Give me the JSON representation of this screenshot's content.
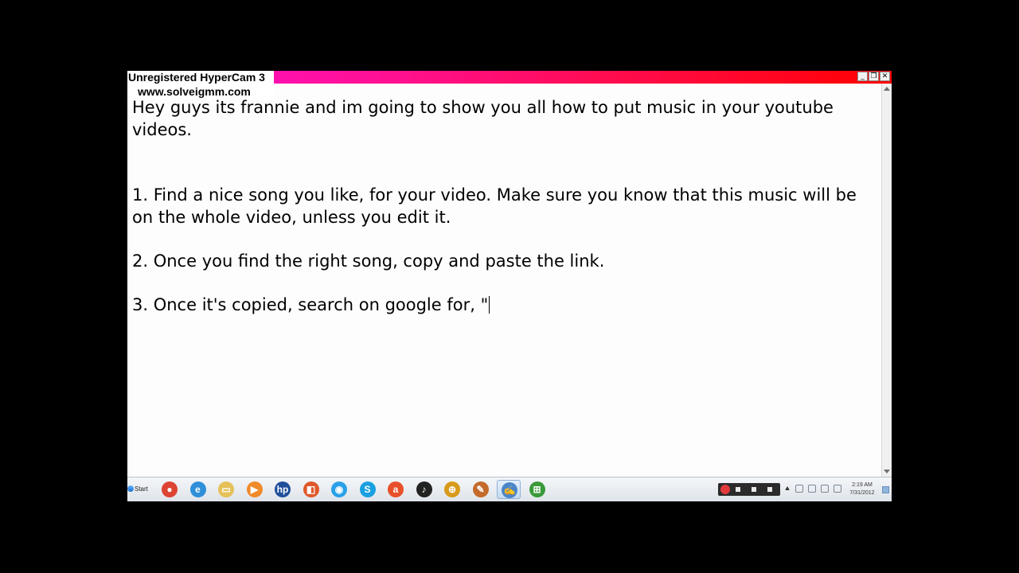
{
  "watermark": {
    "line1": "Unregistered HyperCam 3",
    "line2": "www.solveigmm.com"
  },
  "window_controls": {
    "minimize": "_",
    "restore": "❐",
    "close": "✕"
  },
  "document": {
    "lines": [
      "Hey guys its frannie and im going to show you all how to put music in your youtube videos.",
      "",
      "",
      "1. Find a nice song you like, for your video. Make sure you know that this music will be on the whole video, unless you edit it.",
      "",
      "2. Once you find the right song, copy and paste the link.",
      "",
      "3. Once it's copied, search on google for, \""
    ]
  },
  "taskbar": {
    "start_label": "Start",
    "pinned": [
      {
        "name": "chrome-icon",
        "glyph": "●",
        "color": "#dd4433"
      },
      {
        "name": "internet-explorer-icon",
        "glyph": "e",
        "color": "#2f8fd8"
      },
      {
        "name": "folder-icon",
        "glyph": "▭",
        "color": "#e6c15a"
      },
      {
        "name": "media-player-icon",
        "glyph": "▶",
        "color": "#f08a2a"
      },
      {
        "name": "hp-icon",
        "glyph": "hp",
        "color": "#1f4f9a"
      },
      {
        "name": "office-icon",
        "glyph": "◧",
        "color": "#e0582a"
      },
      {
        "name": "orb-app-icon",
        "glyph": "◉",
        "color": "#2aa0e8"
      },
      {
        "name": "skype-icon",
        "glyph": "S",
        "color": "#19a0e0"
      },
      {
        "name": "aim-icon",
        "glyph": "a",
        "color": "#e8502a"
      },
      {
        "name": "music-app-icon",
        "glyph": "♪",
        "color": "#222222"
      },
      {
        "name": "globe-icon",
        "glyph": "⊕",
        "color": "#d89a1a"
      },
      {
        "name": "paint-icon",
        "glyph": "✎",
        "color": "#c46a2a"
      },
      {
        "name": "wordpad-icon",
        "glyph": "✍",
        "color": "#4a86c8"
      },
      {
        "name": "windows-icon",
        "glyph": "⊞",
        "color": "#3a9a3a"
      }
    ],
    "clock_time": "2:19 AM",
    "clock_date": "7/31/2012"
  }
}
